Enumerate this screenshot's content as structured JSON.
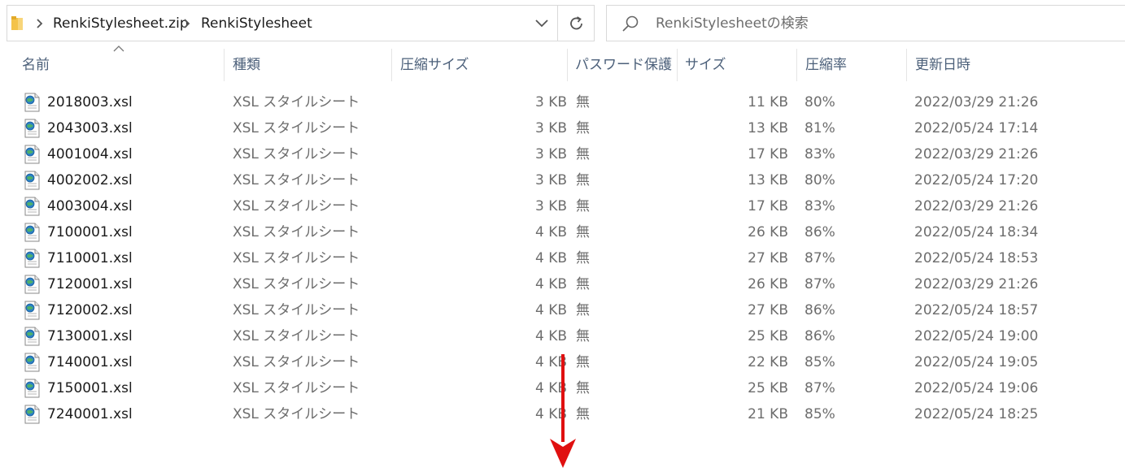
{
  "address": {
    "crumbs": [
      "RenkiStylesheet.zip",
      "RenkiStylesheet"
    ]
  },
  "search": {
    "placeholder": "RenkiStylesheetの検索"
  },
  "columns": {
    "name": "名前",
    "type": "種類",
    "compressed": "圧縮サイズ",
    "password": "パスワード保護",
    "size": "サイズ",
    "ratio": "圧縮率",
    "modified": "更新日時"
  },
  "files": [
    {
      "name": "2018003.xsl",
      "type": "XSL スタイルシート",
      "compressed": "3 KB",
      "password": "無",
      "size": "11 KB",
      "ratio": "80%",
      "modified": "2022/03/29 21:26"
    },
    {
      "name": "2043003.xsl",
      "type": "XSL スタイルシート",
      "compressed": "3 KB",
      "password": "無",
      "size": "13 KB",
      "ratio": "81%",
      "modified": "2022/05/24 17:14"
    },
    {
      "name": "4001004.xsl",
      "type": "XSL スタイルシート",
      "compressed": "3 KB",
      "password": "無",
      "size": "17 KB",
      "ratio": "83%",
      "modified": "2022/03/29 21:26"
    },
    {
      "name": "4002002.xsl",
      "type": "XSL スタイルシート",
      "compressed": "3 KB",
      "password": "無",
      "size": "13 KB",
      "ratio": "80%",
      "modified": "2022/05/24 17:20"
    },
    {
      "name": "4003004.xsl",
      "type": "XSL スタイルシート",
      "compressed": "3 KB",
      "password": "無",
      "size": "17 KB",
      "ratio": "83%",
      "modified": "2022/03/29 21:26"
    },
    {
      "name": "7100001.xsl",
      "type": "XSL スタイルシート",
      "compressed": "4 KB",
      "password": "無",
      "size": "26 KB",
      "ratio": "86%",
      "modified": "2022/05/24 18:34"
    },
    {
      "name": "7110001.xsl",
      "type": "XSL スタイルシート",
      "compressed": "4 KB",
      "password": "無",
      "size": "27 KB",
      "ratio": "87%",
      "modified": "2022/05/24 18:53"
    },
    {
      "name": "7120001.xsl",
      "type": "XSL スタイルシート",
      "compressed": "4 KB",
      "password": "無",
      "size": "26 KB",
      "ratio": "87%",
      "modified": "2022/03/29 21:26"
    },
    {
      "name": "7120002.xsl",
      "type": "XSL スタイルシート",
      "compressed": "4 KB",
      "password": "無",
      "size": "27 KB",
      "ratio": "86%",
      "modified": "2022/05/24 18:57"
    },
    {
      "name": "7130001.xsl",
      "type": "XSL スタイルシート",
      "compressed": "4 KB",
      "password": "無",
      "size": "25 KB",
      "ratio": "86%",
      "modified": "2022/05/24 19:00"
    },
    {
      "name": "7140001.xsl",
      "type": "XSL スタイルシート",
      "compressed": "4 KB",
      "password": "無",
      "size": "22 KB",
      "ratio": "85%",
      "modified": "2022/05/24 19:05"
    },
    {
      "name": "7150001.xsl",
      "type": "XSL スタイルシート",
      "compressed": "4 KB",
      "password": "無",
      "size": "25 KB",
      "ratio": "87%",
      "modified": "2022/05/24 19:06"
    },
    {
      "name": "7240001.xsl",
      "type": "XSL スタイルシート",
      "compressed": "4 KB",
      "password": "無",
      "size": "21 KB",
      "ratio": "85%",
      "modified": "2022/05/24 18:25"
    }
  ],
  "icons": {
    "folder": "folder-icon",
    "breadcrumb_separator": "chevron-right-icon",
    "address_dropdown": "chevron-down-icon",
    "refresh": "refresh-icon",
    "search": "search-icon",
    "sort_indicator": "sort-ascending-icon",
    "file": "xsl-file-icon",
    "annotation": "down-arrow-icon"
  },
  "colors": {
    "header_text": "#4c607a",
    "annotation_arrow": "#e01010",
    "border": "#d9d9d9"
  }
}
